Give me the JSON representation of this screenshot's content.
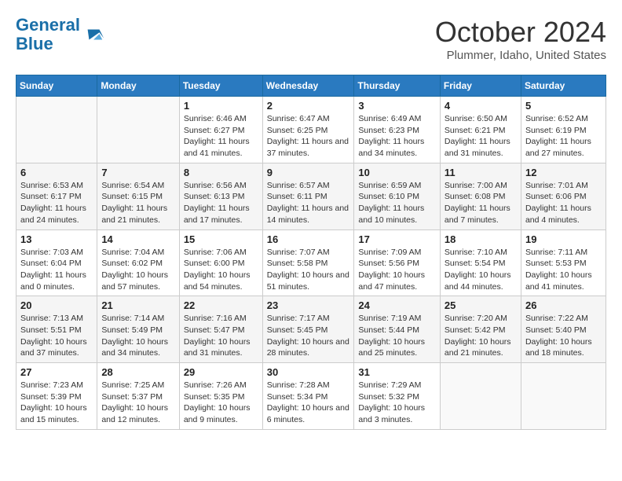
{
  "header": {
    "logo_line1": "General",
    "logo_line2": "Blue",
    "month": "October 2024",
    "location": "Plummer, Idaho, United States"
  },
  "days_of_week": [
    "Sunday",
    "Monday",
    "Tuesday",
    "Wednesday",
    "Thursday",
    "Friday",
    "Saturday"
  ],
  "weeks": [
    [
      {
        "day": "",
        "info": ""
      },
      {
        "day": "",
        "info": ""
      },
      {
        "day": "1",
        "info": "Sunrise: 6:46 AM\nSunset: 6:27 PM\nDaylight: 11 hours and 41 minutes."
      },
      {
        "day": "2",
        "info": "Sunrise: 6:47 AM\nSunset: 6:25 PM\nDaylight: 11 hours and 37 minutes."
      },
      {
        "day": "3",
        "info": "Sunrise: 6:49 AM\nSunset: 6:23 PM\nDaylight: 11 hours and 34 minutes."
      },
      {
        "day": "4",
        "info": "Sunrise: 6:50 AM\nSunset: 6:21 PM\nDaylight: 11 hours and 31 minutes."
      },
      {
        "day": "5",
        "info": "Sunrise: 6:52 AM\nSunset: 6:19 PM\nDaylight: 11 hours and 27 minutes."
      }
    ],
    [
      {
        "day": "6",
        "info": "Sunrise: 6:53 AM\nSunset: 6:17 PM\nDaylight: 11 hours and 24 minutes."
      },
      {
        "day": "7",
        "info": "Sunrise: 6:54 AM\nSunset: 6:15 PM\nDaylight: 11 hours and 21 minutes."
      },
      {
        "day": "8",
        "info": "Sunrise: 6:56 AM\nSunset: 6:13 PM\nDaylight: 11 hours and 17 minutes."
      },
      {
        "day": "9",
        "info": "Sunrise: 6:57 AM\nSunset: 6:11 PM\nDaylight: 11 hours and 14 minutes."
      },
      {
        "day": "10",
        "info": "Sunrise: 6:59 AM\nSunset: 6:10 PM\nDaylight: 11 hours and 10 minutes."
      },
      {
        "day": "11",
        "info": "Sunrise: 7:00 AM\nSunset: 6:08 PM\nDaylight: 11 hours and 7 minutes."
      },
      {
        "day": "12",
        "info": "Sunrise: 7:01 AM\nSunset: 6:06 PM\nDaylight: 11 hours and 4 minutes."
      }
    ],
    [
      {
        "day": "13",
        "info": "Sunrise: 7:03 AM\nSunset: 6:04 PM\nDaylight: 11 hours and 0 minutes."
      },
      {
        "day": "14",
        "info": "Sunrise: 7:04 AM\nSunset: 6:02 PM\nDaylight: 10 hours and 57 minutes."
      },
      {
        "day": "15",
        "info": "Sunrise: 7:06 AM\nSunset: 6:00 PM\nDaylight: 10 hours and 54 minutes."
      },
      {
        "day": "16",
        "info": "Sunrise: 7:07 AM\nSunset: 5:58 PM\nDaylight: 10 hours and 51 minutes."
      },
      {
        "day": "17",
        "info": "Sunrise: 7:09 AM\nSunset: 5:56 PM\nDaylight: 10 hours and 47 minutes."
      },
      {
        "day": "18",
        "info": "Sunrise: 7:10 AM\nSunset: 5:54 PM\nDaylight: 10 hours and 44 minutes."
      },
      {
        "day": "19",
        "info": "Sunrise: 7:11 AM\nSunset: 5:53 PM\nDaylight: 10 hours and 41 minutes."
      }
    ],
    [
      {
        "day": "20",
        "info": "Sunrise: 7:13 AM\nSunset: 5:51 PM\nDaylight: 10 hours and 37 minutes."
      },
      {
        "day": "21",
        "info": "Sunrise: 7:14 AM\nSunset: 5:49 PM\nDaylight: 10 hours and 34 minutes."
      },
      {
        "day": "22",
        "info": "Sunrise: 7:16 AM\nSunset: 5:47 PM\nDaylight: 10 hours and 31 minutes."
      },
      {
        "day": "23",
        "info": "Sunrise: 7:17 AM\nSunset: 5:45 PM\nDaylight: 10 hours and 28 minutes."
      },
      {
        "day": "24",
        "info": "Sunrise: 7:19 AM\nSunset: 5:44 PM\nDaylight: 10 hours and 25 minutes."
      },
      {
        "day": "25",
        "info": "Sunrise: 7:20 AM\nSunset: 5:42 PM\nDaylight: 10 hours and 21 minutes."
      },
      {
        "day": "26",
        "info": "Sunrise: 7:22 AM\nSunset: 5:40 PM\nDaylight: 10 hours and 18 minutes."
      }
    ],
    [
      {
        "day": "27",
        "info": "Sunrise: 7:23 AM\nSunset: 5:39 PM\nDaylight: 10 hours and 15 minutes."
      },
      {
        "day": "28",
        "info": "Sunrise: 7:25 AM\nSunset: 5:37 PM\nDaylight: 10 hours and 12 minutes."
      },
      {
        "day": "29",
        "info": "Sunrise: 7:26 AM\nSunset: 5:35 PM\nDaylight: 10 hours and 9 minutes."
      },
      {
        "day": "30",
        "info": "Sunrise: 7:28 AM\nSunset: 5:34 PM\nDaylight: 10 hours and 6 minutes."
      },
      {
        "day": "31",
        "info": "Sunrise: 7:29 AM\nSunset: 5:32 PM\nDaylight: 10 hours and 3 minutes."
      },
      {
        "day": "",
        "info": ""
      },
      {
        "day": "",
        "info": ""
      }
    ]
  ]
}
